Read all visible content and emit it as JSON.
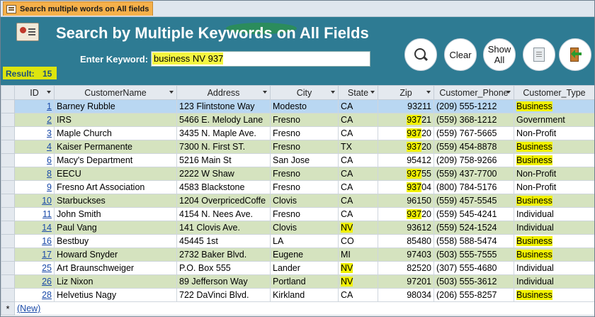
{
  "tab": {
    "label": "Search multiple words on All fields"
  },
  "header": {
    "title": "Search by Multiple Keywords on All Fields",
    "keyword_label": "Enter Keyword:",
    "keyword_value": "business NV 937",
    "result_label": "Result:",
    "result_count": "15"
  },
  "buttons": {
    "clear": "Clear",
    "show_all_1": "Show",
    "show_all_2": "All"
  },
  "icons": {
    "search": "search-icon",
    "report": "report-icon",
    "exit": "exit-icon"
  },
  "colors": {
    "header": "#2e7b93",
    "alt_row": "#d5e3bf",
    "current_row": "#b9d7f2",
    "highlight": "#f1f100",
    "tab": "#f5b04a"
  },
  "columns": [
    "ID",
    "CustomerName",
    "Address",
    "City",
    "State",
    "Zip",
    "Customer_Phone",
    "Customer_Type"
  ],
  "rows": [
    {
      "id": "1",
      "name": "Barney Rubble",
      "address": "123 Flintstone Way",
      "city": "Modesto",
      "state": "CA",
      "zip": "93211",
      "phone": "(209) 555-1212",
      "type": "Business"
    },
    {
      "id": "2",
      "name": "IRS",
      "address": "5466 E. Melody Lane",
      "city": "Fresno",
      "state": "CA",
      "zip": "93721",
      "phone": "(559) 368-1212",
      "type": "Government"
    },
    {
      "id": "3",
      "name": "Maple Church",
      "address": "3435 N. Maple Ave.",
      "city": "Fresno",
      "state": "CA",
      "zip": "93720",
      "phone": "(559) 767-5665",
      "type": "Non-Profit"
    },
    {
      "id": "4",
      "name": "Kaiser Permanente",
      "address": "7300 N. First ST.",
      "city": "Fresno",
      "state": "TX",
      "zip": "93720",
      "phone": "(559) 454-8878",
      "type": "Business"
    },
    {
      "id": "6",
      "name": "Macy's Department",
      "address": "5216 Main St",
      "city": "San Jose",
      "state": "CA",
      "zip": "95412",
      "phone": "(209) 758-9266",
      "type": "Business"
    },
    {
      "id": "8",
      "name": "EECU",
      "address": "2222 W Shaw",
      "city": "Fresno",
      "state": "CA",
      "zip": "93755",
      "phone": "(559) 437-7700",
      "type": "Non-Profit"
    },
    {
      "id": "9",
      "name": "Fresno Art Association",
      "address": "4583 Blackstone",
      "city": "Fresno",
      "state": "CA",
      "zip": "93704",
      "phone": "(800) 784-5176",
      "type": "Non-Profit"
    },
    {
      "id": "10",
      "name": "Starbuckses",
      "address": "1204 OverpricedCoffe",
      "city": "Clovis",
      "state": "CA",
      "zip": "96150",
      "phone": "(559) 457-5545",
      "type": "Business"
    },
    {
      "id": "11",
      "name": "John Smith",
      "address": "4154 N. Nees Ave.",
      "city": "Fresno",
      "state": "CA",
      "zip": "93720",
      "phone": "(559) 545-4241",
      "type": "Individual"
    },
    {
      "id": "14",
      "name": "Paul Vang",
      "address": "141 Clovis Ave.",
      "city": "Clovis",
      "state": "NV",
      "zip": "93612",
      "phone": "(559) 524-1524",
      "type": "Individual"
    },
    {
      "id": "16",
      "name": "Bestbuy",
      "address": "45445 1st",
      "city": "LA",
      "state": "CO",
      "zip": "85480",
      "phone": "(558) 588-5474",
      "type": "Business"
    },
    {
      "id": "17",
      "name": "Howard Snyder",
      "address": "2732 Baker Blvd.",
      "city": "Eugene",
      "state": "MI",
      "zip": "97403",
      "phone": "(503) 555-7555",
      "type": "Business"
    },
    {
      "id": "25",
      "name": "Art Braunschweiger",
      "address": "P.O. Box 555",
      "city": "Lander",
      "state": "NV",
      "zip": "82520",
      "phone": "(307) 555-4680",
      "type": "Individual"
    },
    {
      "id": "26",
      "name": "Liz Nixon",
      "address": "89 Jefferson Way",
      "city": "Portland",
      "state": "NV",
      "zip": "97201",
      "phone": "(503) 555-3612",
      "type": "Individual"
    },
    {
      "id": "28",
      "name": "Helvetius Nagy",
      "address": "722 DaVinci Blvd.",
      "city": "Kirkland",
      "state": "CA",
      "zip": "98034",
      "phone": "(206) 555-8257",
      "type": "Business"
    }
  ],
  "new_row": {
    "marker": "*",
    "label": "(New)"
  }
}
